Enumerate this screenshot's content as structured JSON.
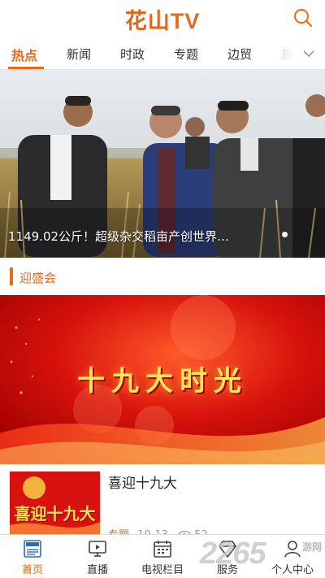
{
  "header": {
    "logo_cn": "花山",
    "logo_tv": "TV",
    "search_icon": "search-icon"
  },
  "tabs": [
    {
      "label": "热点",
      "active": true
    },
    {
      "label": "新闻",
      "active": false
    },
    {
      "label": "时政",
      "active": false
    },
    {
      "label": "专题",
      "active": false
    },
    {
      "label": "边贸",
      "active": false
    },
    {
      "label": "旅",
      "active": false
    }
  ],
  "tabs_more_icon": "chevron-down-icon",
  "hero": {
    "caption": "1149.02公斤！超级杂交稻亩产创世界…",
    "page_dots": 1
  },
  "section": {
    "title": "迎盛会"
  },
  "feature": {
    "title": "十九大时光"
  },
  "article": {
    "title": "喜迎十九大",
    "thumb_text": "喜迎十九大",
    "tag": "专题",
    "date": "10-13",
    "views": "52"
  },
  "bottom_nav": [
    {
      "label": "首页",
      "icon": "news-icon",
      "active": true
    },
    {
      "label": "直播",
      "icon": "tv-monitor-icon",
      "active": false
    },
    {
      "label": "电视栏目",
      "icon": "calendar-icon",
      "active": false
    },
    {
      "label": "服务",
      "icon": "diamond-icon",
      "active": false
    },
    {
      "label": "个人中心",
      "icon": "user-icon",
      "active": false
    }
  ],
  "watermark": {
    "big": "2265",
    "small": "游网"
  },
  "colors": {
    "accent": "#ea6a1a",
    "banner_red": "#d8120e",
    "gold": "#ffe55a"
  }
}
